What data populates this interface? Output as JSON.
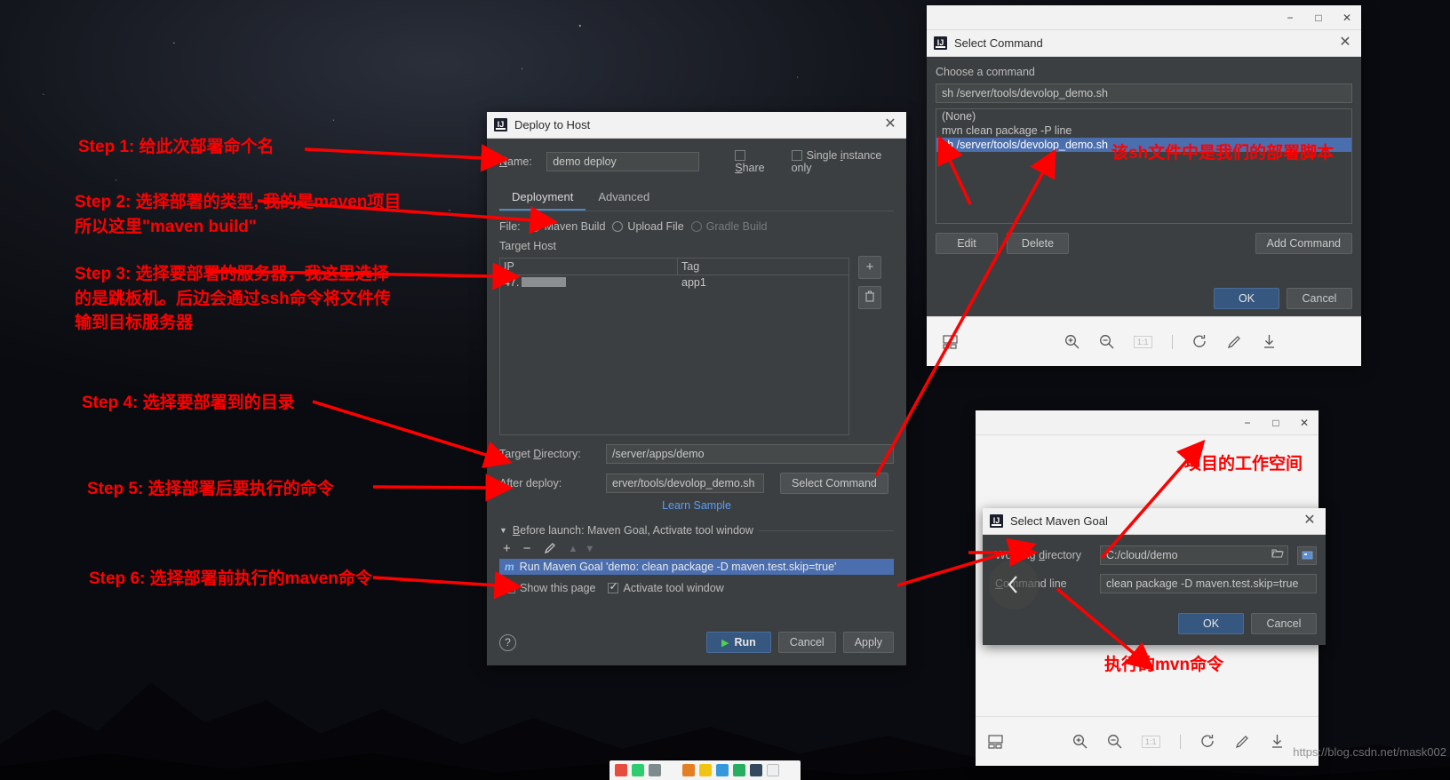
{
  "deploy_dialog": {
    "title": "Deploy to Host",
    "close_label": "✕",
    "name_label": "Name:",
    "name_value": "demo deploy",
    "share_label": "Share",
    "single_instance_label": "Single instance only",
    "tabs": [
      {
        "label": "Deployment",
        "active": true
      },
      {
        "label": "Advanced",
        "active": false
      }
    ],
    "file_label": "File:",
    "file_options": [
      {
        "label": "Maven Build",
        "selected": true,
        "disabled": false
      },
      {
        "label": "Upload File",
        "selected": false,
        "disabled": false
      },
      {
        "label": "Gradle Build",
        "selected": false,
        "disabled": true
      }
    ],
    "target_host_label": "Target Host",
    "host_table": {
      "columns": [
        "IP",
        "Tag"
      ],
      "rows": [
        {
          "ip": "47.",
          "tag": "app1"
        }
      ]
    },
    "add_host_icon": "+",
    "delete_host_icon": "trash",
    "target_directory_label": "Target Directory:",
    "target_directory_value": "/server/apps/demo",
    "after_deploy_label": "After deploy:",
    "after_deploy_value": "erver/tools/devolop_demo.sh",
    "select_command_button": "Select Command",
    "learn_sample_link": "Learn Sample",
    "before_launch_header": "Before launch: Maven Goal, Activate tool window",
    "before_launch_tools": [
      "+",
      "−",
      "pencil-icon",
      "arrow-up-icon",
      "arrow-down-icon"
    ],
    "before_launch_item": "Run Maven Goal 'demo: clean package -D maven.test.skip=true'",
    "before_launch_item_badge": "m",
    "show_this_page_label": "Show this page",
    "show_this_page_checked": false,
    "activate_tool_window_label": "Activate tool window",
    "activate_tool_window_checked": true,
    "help_label": "?",
    "run_label": "Run",
    "cancel_label": "Cancel",
    "apply_label": "Apply"
  },
  "select_command_window": {
    "window_controls": [
      "−",
      "□",
      "✕"
    ],
    "title": "Select Command",
    "close_label": "✕",
    "choose_label": "Choose a command",
    "command_value": "sh /server/tools/devolop_demo.sh",
    "list_items": [
      {
        "label": "(None)",
        "selected": false
      },
      {
        "label": "mvn clean package -P line",
        "selected": false
      },
      {
        "label": "sh /server/tools/devolop_demo.sh",
        "selected": true
      }
    ],
    "edit_label": "Edit",
    "delete_label": "Delete",
    "add_command_label": "Add Command",
    "ok_label": "OK",
    "cancel_label": "Cancel",
    "toolbar_icons": [
      "layout-icon",
      "zoom-in-icon",
      "zoom-out-icon",
      "actual-size-icon",
      "rotate-icon",
      "edit-icon",
      "download-icon"
    ],
    "actual_size_label": "1:1"
  },
  "maven_goal_dialog": {
    "window_controls": [
      "−",
      "□",
      "✕"
    ],
    "title": "Select Maven Goal",
    "close_label": "✕",
    "working_directory_label": "Working directory",
    "working_directory_value": "C:/cloud/demo",
    "folder_icon": "folder-icon",
    "module_icon": "module-icon",
    "command_line_label": "Command line",
    "command_line_value": "clean package -D maven.test.skip=true",
    "back_icon": "back-arrow-icon",
    "ok_label": "OK",
    "cancel_label": "Cancel",
    "toolbar_icons": [
      "layout-icon",
      "zoom-in-icon",
      "zoom-out-icon",
      "actual-size-icon",
      "rotate-icon",
      "edit-icon",
      "download-icon"
    ],
    "actual_size_label": "1:1"
  },
  "annotations": {
    "step1": "Step 1: 给此次部署命个名",
    "step2": "Step 2: 选择部署的类型, 我的是maven项目\n所以这里\"maven build\"",
    "step3": "Step 3: 选择要部署的服务器，我这里选择\n的是跳板机。后边会通过ssh命令将文件传\n输到目标服务器",
    "step4": "Step 4: 选择要部署到的目录",
    "step5": "Step 5: 选择部署后要执行的命令",
    "step6": "Step 6: 选择部署前执行的maven命令",
    "sh_note": "该sh文件中是我们的部署脚本",
    "workspace_note": "项目的工作空间",
    "mvn_note": "执行的mvn命令"
  },
  "watermark": "https://blog.csdn.net/mask002",
  "colors": {
    "annotation_red": "#ff0000",
    "selection_blue": "#4b6eaf",
    "primary_button": "#365880",
    "dialog_bg": "#3c3f41",
    "link_blue": "#589df6"
  }
}
